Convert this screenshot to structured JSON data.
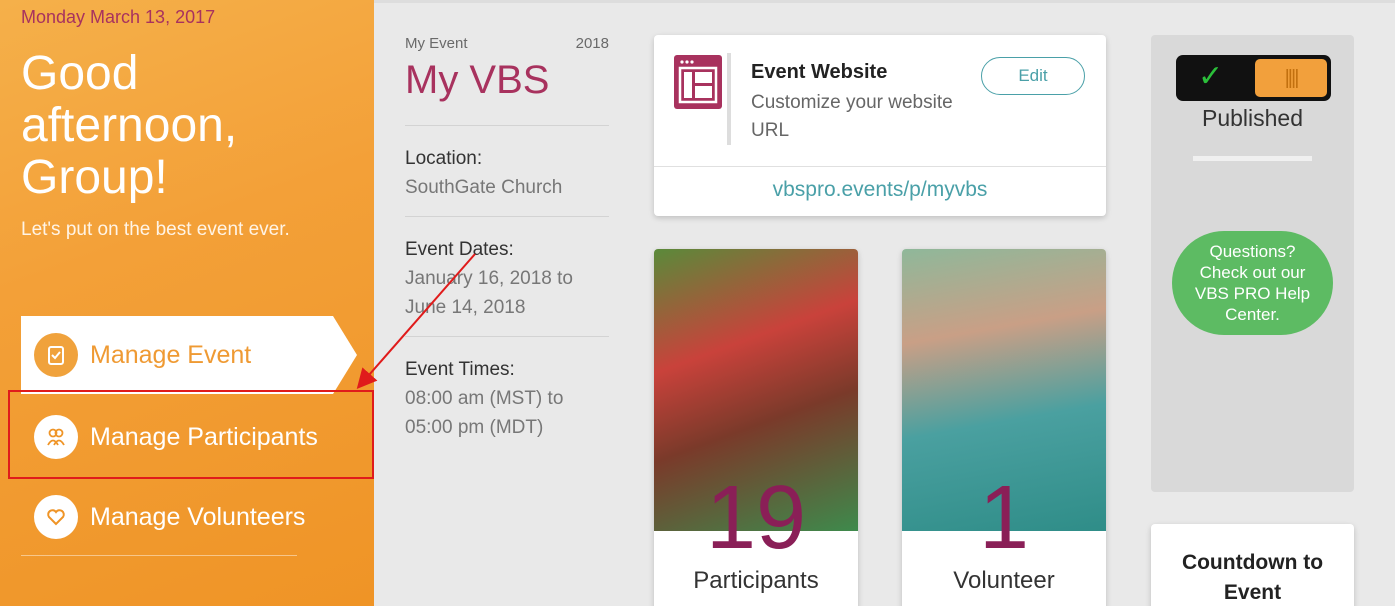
{
  "sidebar": {
    "date": "Monday March 13, 2017",
    "greeting": "Good afternoon, Group!",
    "tagline": "Let's put on the best event ever.",
    "nav": [
      {
        "label": "Manage Event",
        "icon": "clipboard-check-icon"
      },
      {
        "label": "Manage Participants",
        "icon": "people-icon"
      },
      {
        "label": "Manage Volunteers",
        "icon": "heart-icon"
      }
    ]
  },
  "event": {
    "label": "My Event",
    "year": "2018",
    "name": "My VBS",
    "location_label": "Location:",
    "location": "SouthGate Church",
    "dates_label": "Event Dates:",
    "dates": "January 16, 2018 to June 14, 2018",
    "times_label": "Event Times:",
    "times": "08:00 am (MST) to 05:00 pm (MDT)"
  },
  "website": {
    "title": "Event Website",
    "subtitle": "Customize your website URL",
    "edit_label": "Edit",
    "url": "vbspro.events/p/myvbs"
  },
  "stats": [
    {
      "number": "19",
      "label": "Participants"
    },
    {
      "number": "1",
      "label": "Volunteer"
    }
  ],
  "publish": {
    "state": "Published",
    "check": "✓",
    "knob_grip": "||||"
  },
  "help": {
    "text": "Questions? Check out our VBS PRO Help Center."
  },
  "countdown": {
    "label": "Countdown to Event"
  },
  "colors": {
    "accent": "#a8325e",
    "orange": "#f3a038",
    "teal": "#4aa0a8",
    "green": "#5dbb63",
    "annotation_red": "#e01b1b"
  }
}
